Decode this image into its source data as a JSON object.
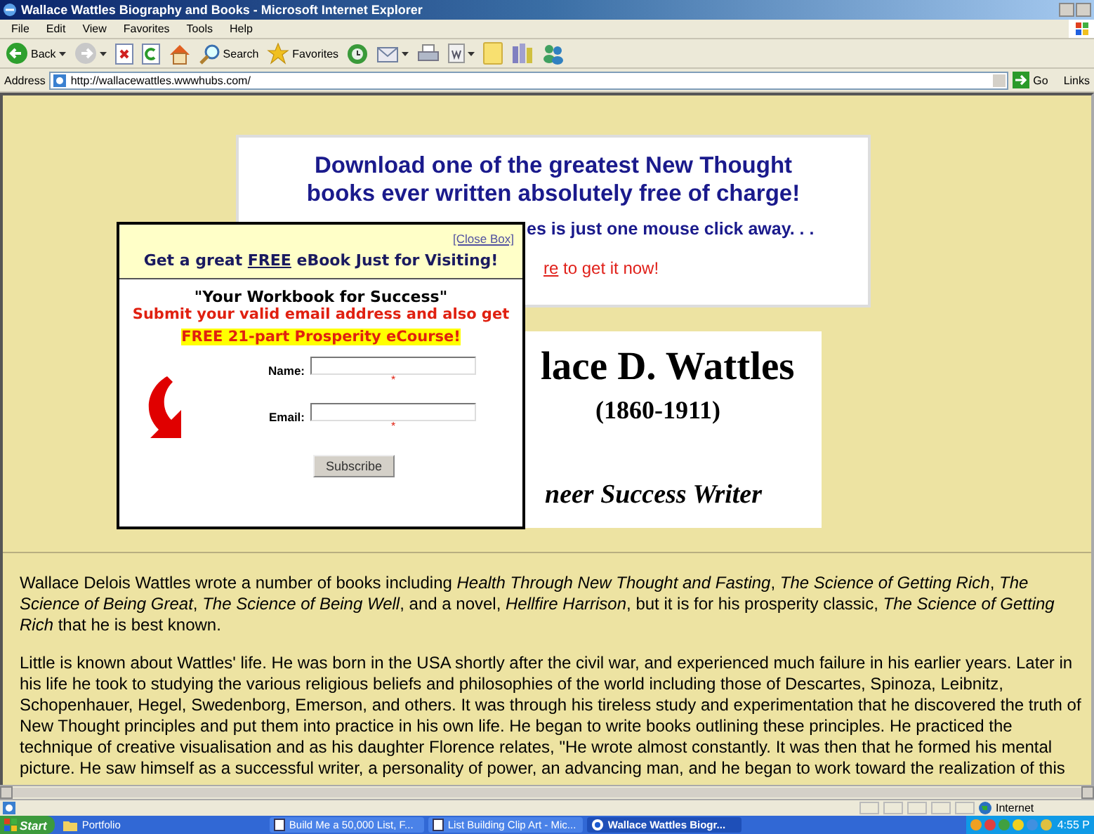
{
  "window": {
    "title": "Wallace Wattles Biography and Books - Microsoft Internet Explorer"
  },
  "menu": [
    "File",
    "Edit",
    "View",
    "Favorites",
    "Tools",
    "Help"
  ],
  "toolbar": [
    {
      "kind": "back",
      "label": "Back"
    },
    {
      "kind": "forward"
    },
    {
      "kind": "stop"
    },
    {
      "kind": "refresh"
    },
    {
      "kind": "home"
    },
    {
      "kind": "search",
      "label": "Search"
    },
    {
      "kind": "favorites",
      "label": "Favorites"
    },
    {
      "kind": "history"
    },
    {
      "kind": "mail"
    },
    {
      "kind": "print"
    },
    {
      "kind": "edit"
    },
    {
      "kind": "note"
    },
    {
      "kind": "research"
    },
    {
      "kind": "messenger"
    }
  ],
  "address": {
    "label": "Address",
    "url": "http://wallacewattles.wwwhubs.com/",
    "go": "Go",
    "links": "Links"
  },
  "banner": {
    "lines": [
      "Download one of the greatest New Thought",
      "books ever written absolutely free of charge!"
    ],
    "partial_line": "es is just one mouse click away. . .",
    "link": "re",
    "link_rest": " to get it now!"
  },
  "portrait": {
    "name": "lace D. Wattles",
    "years": "(1860-1911)",
    "subtitle": "neer Success Writer"
  },
  "popup": {
    "close": "[Close Box]",
    "heading_before": "Get a great ",
    "heading_link": "FREE",
    "heading_after": " eBook Just for Visiting!",
    "book_title": "\"Your Workbook for Success\"",
    "offer": "Submit your valid email address and also get",
    "highlight": "FREE 21-part Prosperity eCourse!",
    "fields": [
      {
        "label": "Name:",
        "required_mark": "*"
      },
      {
        "label": "Email:",
        "required_mark": "*"
      }
    ],
    "button": "Subscribe"
  },
  "paragraphs": [
    "Wallace Delois Wattles wrote a number of books including *Health Through New Thought and Fasting*, *The Science of Getting Rich*, *The Science of Being Great*, *The Science of Being Well*, and a novel, *Hellfire Harrison*, but it is for his prosperity classic, *The Science of Getting Rich* that he is best known.",
    "Little is known about Wattles' life. He was born in the USA shortly after the civil war, and experienced much failure in his earlier years. Later in his life he took to studying the various religious beliefs and philosophies of the world including those of Descartes, Spinoza, Leibnitz, Schopenhauer, Hegel, Swedenborg, Emerson, and others. It was through his tireless study and experimentation that he discovered the truth of New Thought principles and put them into practice in his own life. He began to write books outlining these principles. He practiced the technique of creative visualisation and as his daughter Florence relates, \"He wrote almost constantly. It was then that he formed his mental picture. He saw himself as a successful writer, a personality of power, an advancing man, and he began to work toward the realization of this"
  ],
  "status": {
    "zone": "Internet"
  },
  "taskbar": {
    "start": "Start",
    "items": [
      {
        "label": "Portfolio",
        "kind": "folder",
        "selected": false
      },
      {
        "label": "Build Me a 50,000 List, F...",
        "kind": "doc",
        "selected": false
      },
      {
        "label": "List Building Clip Art - Mic...",
        "kind": "doc",
        "selected": false
      },
      {
        "label": "Wallace Wattles Biogr...",
        "kind": "ie",
        "selected": true
      }
    ],
    "clock": "4:55 P"
  }
}
